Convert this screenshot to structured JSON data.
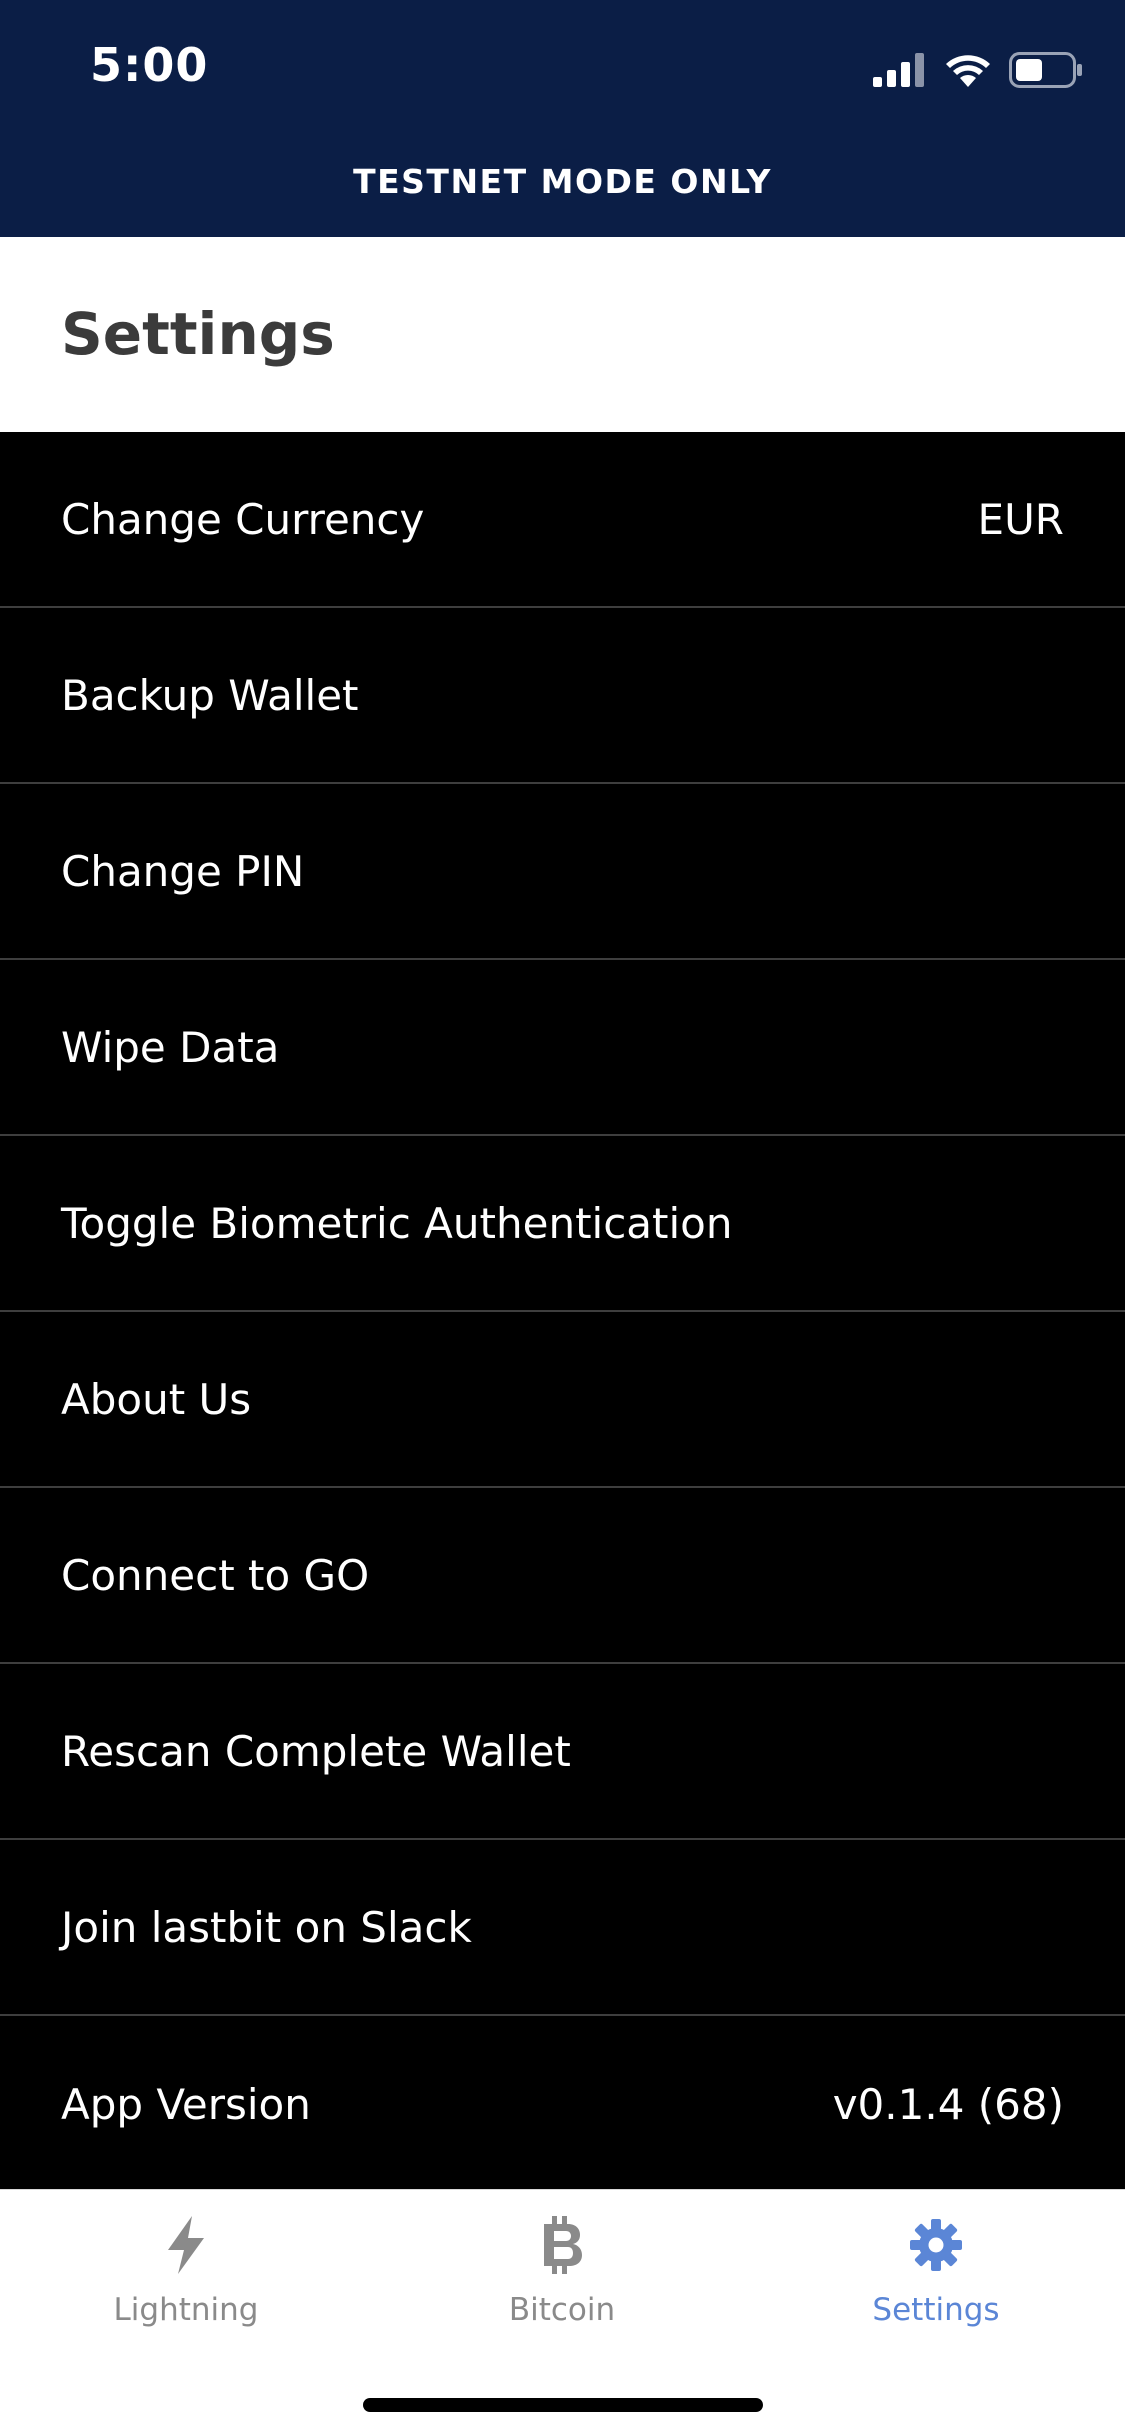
{
  "status_bar": {
    "time": "5:00"
  },
  "banner": {
    "text": "TESTNET MODE ONLY"
  },
  "header": {
    "title": "Settings"
  },
  "settings": {
    "items": [
      {
        "label": "Change Currency",
        "value": "EUR"
      },
      {
        "label": "Backup Wallet",
        "value": ""
      },
      {
        "label": "Change PIN",
        "value": ""
      },
      {
        "label": "Wipe Data",
        "value": ""
      },
      {
        "label": "Toggle Biometric Authentication",
        "value": ""
      },
      {
        "label": "About Us",
        "value": ""
      },
      {
        "label": "Connect to GO",
        "value": ""
      },
      {
        "label": "Rescan Complete Wallet",
        "value": ""
      },
      {
        "label": "Join lastbit on Slack",
        "value": ""
      },
      {
        "label": "App Version",
        "value": "v0.1.4 (68)"
      }
    ]
  },
  "tabbar": {
    "tabs": [
      {
        "label": "Lightning",
        "icon": "lightning-icon"
      },
      {
        "label": "Bitcoin",
        "icon": "bitcoin-icon"
      },
      {
        "label": "Settings",
        "icon": "gear-icon",
        "active": true
      }
    ]
  },
  "colors": {
    "header_bg": "#0b1e46",
    "accent": "#5b86d6",
    "list_bg": "#000000"
  }
}
